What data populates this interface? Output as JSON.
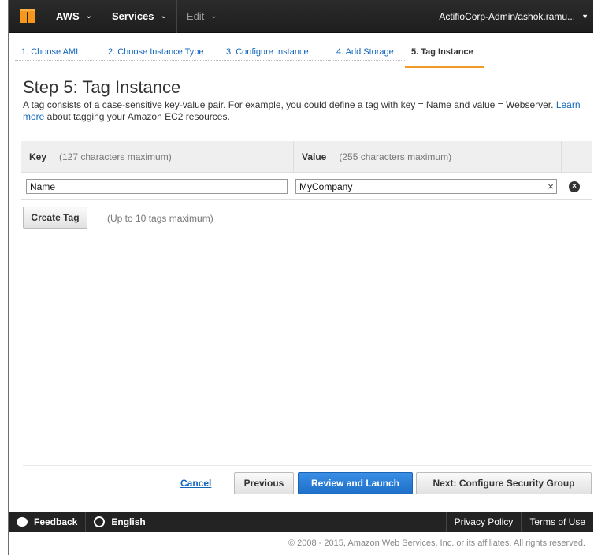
{
  "topnav": {
    "aws_label": "AWS",
    "services_label": "Services",
    "edit_label": "Edit",
    "account": "ActifioCorp-Admin/ashok.ramu..."
  },
  "wizard": {
    "tabs": [
      {
        "label": "1. Choose AMI"
      },
      {
        "label": "2. Choose Instance Type"
      },
      {
        "label": "3. Configure Instance"
      },
      {
        "label": "4. Add Storage"
      },
      {
        "label": "5. Tag Instance"
      }
    ],
    "active_tab": 4
  },
  "page": {
    "title": "Step 5: Tag Instance",
    "description_pre": "A tag consists of a case-sensitive key-value pair. For example, you could define a tag with key = Name and value = Webserver. ",
    "learn_more": "Learn more",
    "description_post": " about tagging your Amazon EC2 resources."
  },
  "tag_table": {
    "key_header": "Key",
    "key_hint": "(127 characters maximum)",
    "value_header": "Value",
    "value_hint": "(255 characters maximum)",
    "rows": [
      {
        "key": "Name",
        "value": "MyCompany"
      }
    ]
  },
  "actions": {
    "create_tag": "Create Tag",
    "create_hint": "(Up to 10 tags maximum)",
    "cancel": "Cancel",
    "previous": "Previous",
    "review_launch": "Review and Launch",
    "next": "Next: Configure Security Group"
  },
  "footer": {
    "feedback": "Feedback",
    "language": "English",
    "privacy": "Privacy Policy",
    "terms": "Terms of Use",
    "copyright": "© 2008 - 2015, Amazon Web Services, Inc. or its affiliates. All rights reserved."
  },
  "colors": {
    "primary_button": "#1d6fc7",
    "active_tab_underline": "#f09b28",
    "link": "#1166bb"
  }
}
